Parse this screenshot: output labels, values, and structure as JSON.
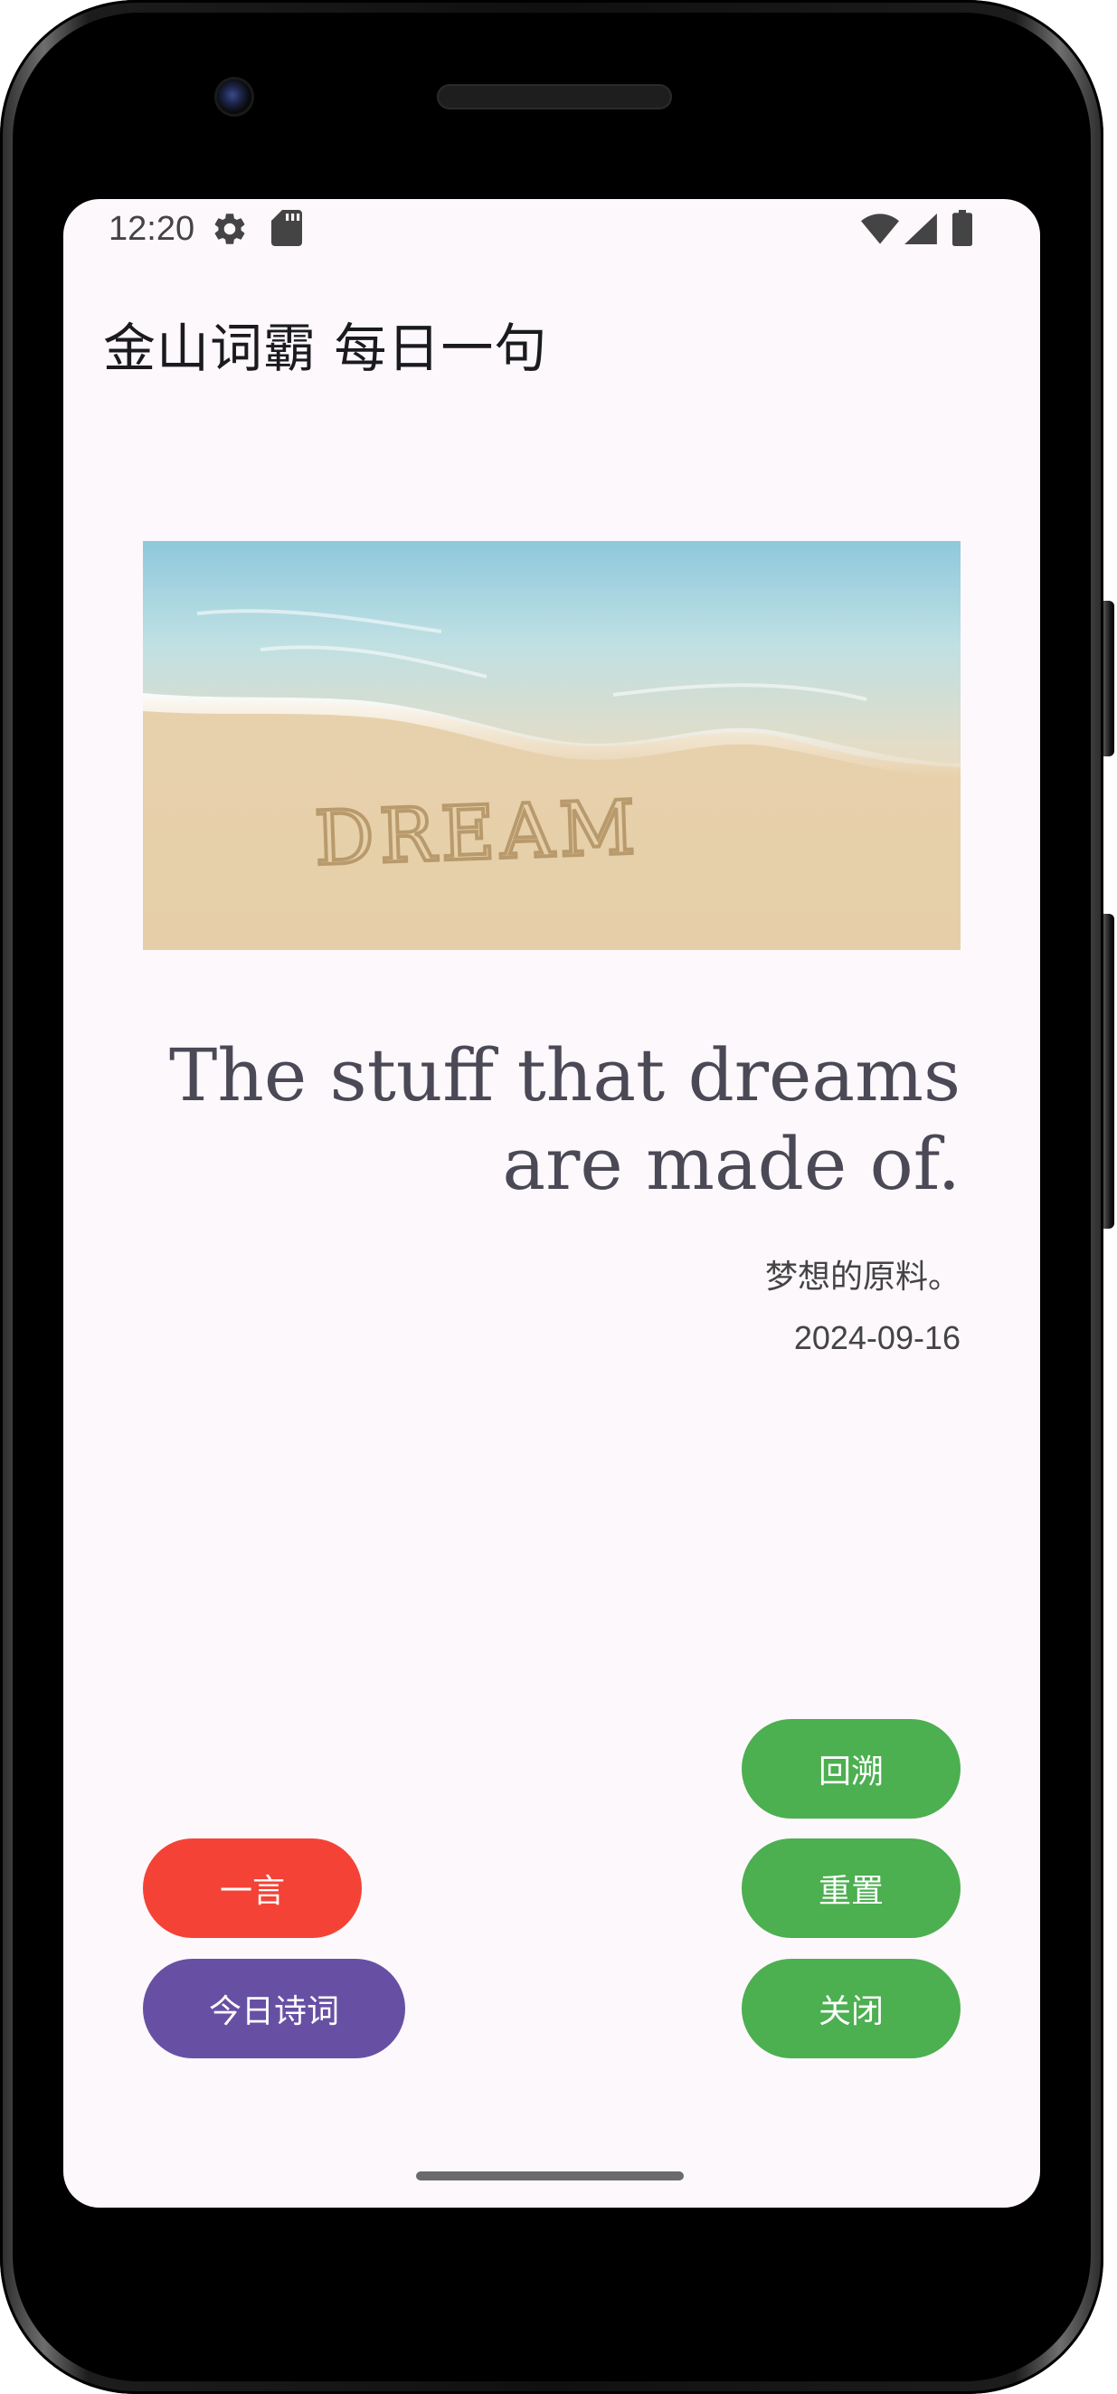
{
  "status_bar": {
    "time": "12:20",
    "icons": [
      "gear-icon",
      "sd-card-icon",
      "wifi-icon",
      "cell-signal-icon",
      "battery-icon"
    ]
  },
  "app": {
    "title": "金山词霸 每日一句"
  },
  "daily": {
    "image_text": "DREAM",
    "sentence_en": "The stuff that dreams are made of.",
    "sentence_zh": "梦想的原料。",
    "date": "2024-09-16"
  },
  "buttons": {
    "rewind": "回溯",
    "reset": "重置",
    "close": "关闭",
    "yiyan": "一言",
    "poetry": "今日诗词"
  },
  "colors": {
    "screen_bg": "#fcf8fc",
    "red": "#f44336",
    "purple": "#6750a4",
    "green": "#4caf50",
    "quote_text": "#4a4955"
  }
}
